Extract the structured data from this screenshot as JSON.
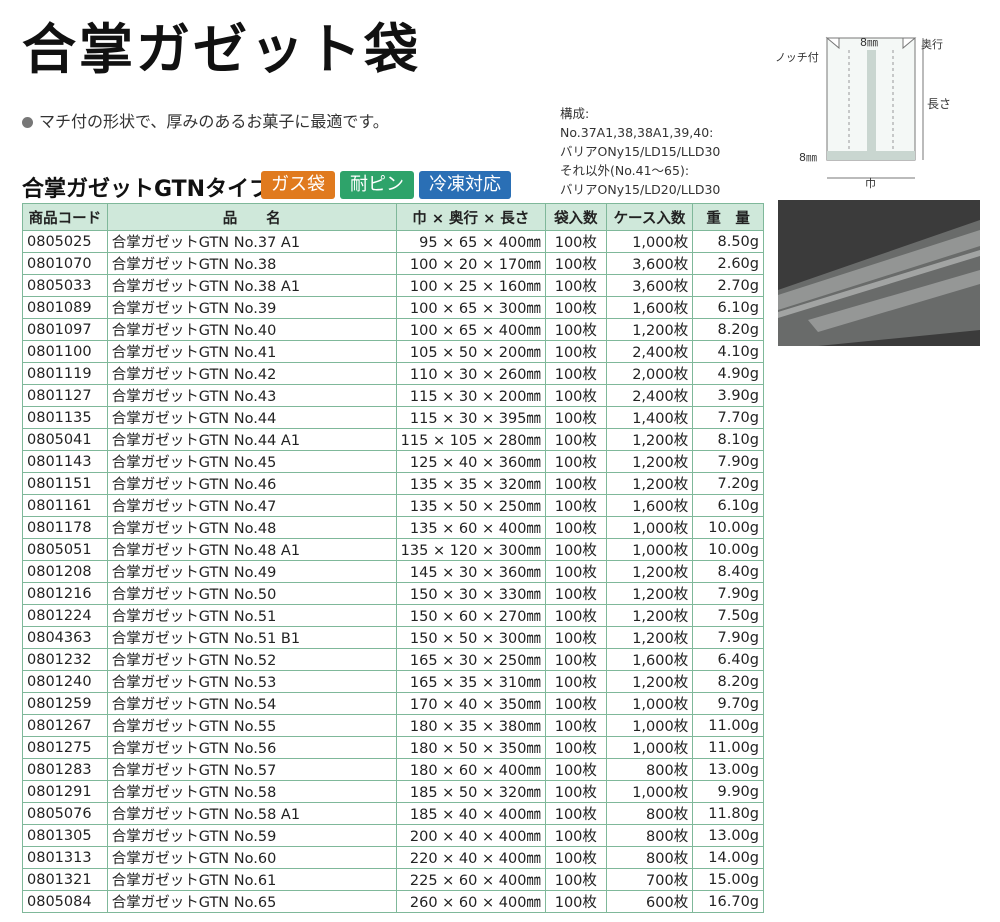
{
  "title": "合掌ガゼット袋",
  "lead": "マチ付の形状で、厚みのあるお菓子に最適です。",
  "composition": {
    "heading": "構成:",
    "line1": "No.37A1,38,38A1,39,40:",
    "line2": "バリアONy15/LD15/LLD30",
    "line3": "それ以外(No.41～65):",
    "line4": "バリアONy15/LD20/LLD30"
  },
  "subtitle": "合掌ガゼットGTNタイプ",
  "badges": [
    {
      "label": "ガス袋",
      "color": "#e07a1e"
    },
    {
      "label": "耐ピン",
      "color": "#2ea36a"
    },
    {
      "label": "冷凍対応",
      "color": "#2a6fb5"
    }
  ],
  "diagram": {
    "notch": "ノッチ付",
    "top_width": "8㎜",
    "depth": "奥行",
    "length": "長さ",
    "left_width": "8㎜",
    "width": "巾"
  },
  "table": {
    "headers": [
      "商品コード",
      "品　　名",
      "巾 × 奥行 × 長さ",
      "袋入数",
      "ケース入数",
      "重　量"
    ],
    "rows": [
      [
        "0805025",
        "合掌ガゼットGTN No.37 A1",
        "95 × 65 × 400㎜",
        "100枚",
        "1,000枚",
        "8.50g"
      ],
      [
        "0801070",
        "合掌ガゼットGTN No.38",
        "100 × 20 × 170㎜",
        "100枚",
        "3,600枚",
        "2.60g"
      ],
      [
        "0805033",
        "合掌ガゼットGTN No.38 A1",
        "100 × 25 × 160㎜",
        "100枚",
        "3,600枚",
        "2.70g"
      ],
      [
        "0801089",
        "合掌ガゼットGTN No.39",
        "100 × 65 × 300㎜",
        "100枚",
        "1,600枚",
        "6.10g"
      ],
      [
        "0801097",
        "合掌ガゼットGTN No.40",
        "100 × 65 × 400㎜",
        "100枚",
        "1,200枚",
        "8.20g"
      ],
      [
        "0801100",
        "合掌ガゼットGTN No.41",
        "105 × 50 × 200㎜",
        "100枚",
        "2,400枚",
        "4.10g"
      ],
      [
        "0801119",
        "合掌ガゼットGTN No.42",
        "110 × 30 × 260㎜",
        "100枚",
        "2,000枚",
        "4.90g"
      ],
      [
        "0801127",
        "合掌ガゼットGTN No.43",
        "115 × 30 × 200㎜",
        "100枚",
        "2,400枚",
        "3.90g"
      ],
      [
        "0801135",
        "合掌ガゼットGTN No.44",
        "115 × 30 × 395㎜",
        "100枚",
        "1,400枚",
        "7.70g"
      ],
      [
        "0805041",
        "合掌ガゼットGTN No.44 A1",
        "115 × 105 × 280㎜",
        "100枚",
        "1,200枚",
        "8.10g"
      ],
      [
        "0801143",
        "合掌ガゼットGTN No.45",
        "125 × 40 × 360㎜",
        "100枚",
        "1,200枚",
        "7.90g"
      ],
      [
        "0801151",
        "合掌ガゼットGTN No.46",
        "135 × 35 × 320㎜",
        "100枚",
        "1,200枚",
        "7.20g"
      ],
      [
        "0801161",
        "合掌ガゼットGTN No.47",
        "135 × 50 × 250㎜",
        "100枚",
        "1,600枚",
        "6.10g"
      ],
      [
        "0801178",
        "合掌ガゼットGTN No.48",
        "135 × 60 × 400㎜",
        "100枚",
        "1,000枚",
        "10.00g"
      ],
      [
        "0805051",
        "合掌ガゼットGTN No.48 A1",
        "135 × 120 × 300㎜",
        "100枚",
        "1,000枚",
        "10.00g"
      ],
      [
        "0801208",
        "合掌ガゼットGTN No.49",
        "145 × 30 × 360㎜",
        "100枚",
        "1,200枚",
        "8.40g"
      ],
      [
        "0801216",
        "合掌ガゼットGTN No.50",
        "150 × 30 × 330㎜",
        "100枚",
        "1,200枚",
        "7.90g"
      ],
      [
        "0801224",
        "合掌ガゼットGTN No.51",
        "150 × 60 × 270㎜",
        "100枚",
        "1,200枚",
        "7.50g"
      ],
      [
        "0804363",
        "合掌ガゼットGTN No.51 B1",
        "150 × 50 × 300㎜",
        "100枚",
        "1,200枚",
        "7.90g"
      ],
      [
        "0801232",
        "合掌ガゼットGTN No.52",
        "165 × 30 × 250㎜",
        "100枚",
        "1,600枚",
        "6.40g"
      ],
      [
        "0801240",
        "合掌ガゼットGTN No.53",
        "165 × 35 × 310㎜",
        "100枚",
        "1,200枚",
        "8.20g"
      ],
      [
        "0801259",
        "合掌ガゼットGTN No.54",
        "170 × 40 × 350㎜",
        "100枚",
        "1,000枚",
        "9.70g"
      ],
      [
        "0801267",
        "合掌ガゼットGTN No.55",
        "180 × 35 × 380㎜",
        "100枚",
        "1,000枚",
        "11.00g"
      ],
      [
        "0801275",
        "合掌ガゼットGTN No.56",
        "180 × 50 × 350㎜",
        "100枚",
        "1,000枚",
        "11.00g"
      ],
      [
        "0801283",
        "合掌ガゼットGTN No.57",
        "180 × 60 × 400㎜",
        "100枚",
        "800枚",
        "13.00g"
      ],
      [
        "0801291",
        "合掌ガゼットGTN No.58",
        "185 × 50 × 320㎜",
        "100枚",
        "1,000枚",
        "9.90g"
      ],
      [
        "0805076",
        "合掌ガゼットGTN No.58 A1",
        "185 × 40 × 400㎜",
        "100枚",
        "800枚",
        "11.80g"
      ],
      [
        "0801305",
        "合掌ガゼットGTN No.59",
        "200 × 40 × 400㎜",
        "100枚",
        "800枚",
        "13.00g"
      ],
      [
        "0801313",
        "合掌ガゼットGTN No.60",
        "220 × 40 × 400㎜",
        "100枚",
        "800枚",
        "14.00g"
      ],
      [
        "0801321",
        "合掌ガゼットGTN No.61",
        "225 × 60 × 400㎜",
        "100枚",
        "700枚",
        "15.00g"
      ],
      [
        "0805084",
        "合掌ガゼットGTN No.65",
        "260 × 60 × 400㎜",
        "100枚",
        "600枚",
        "16.70g"
      ]
    ]
  }
}
